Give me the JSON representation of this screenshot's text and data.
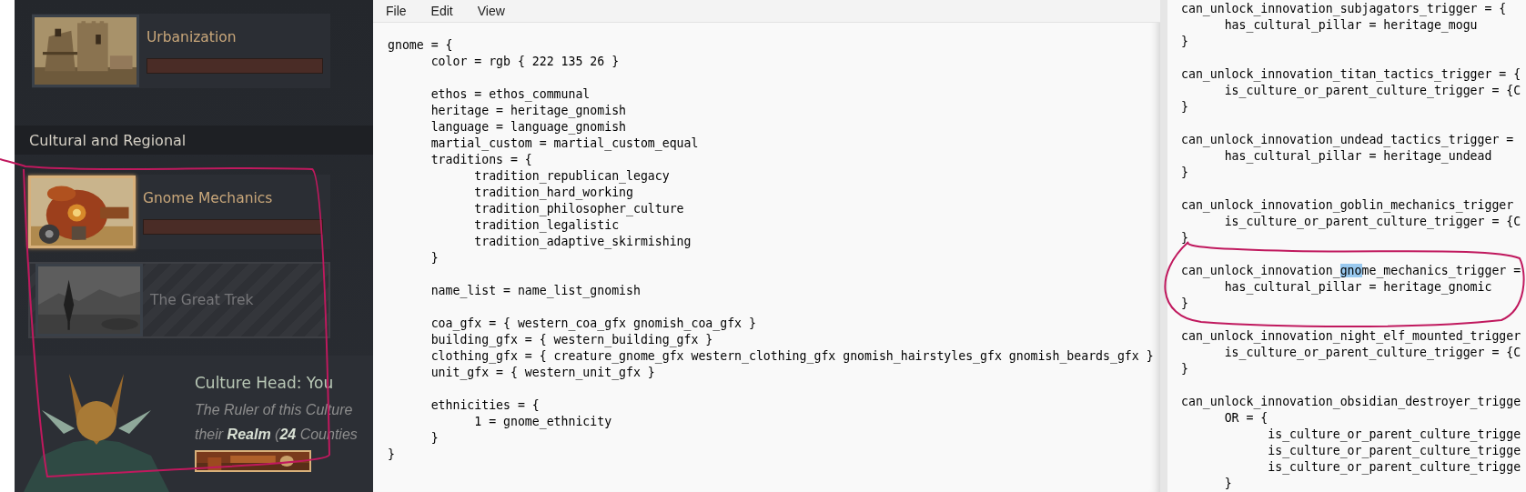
{
  "innovation_panel": {
    "cards": [
      {
        "title": "Urbanization",
        "selected": false,
        "locked": false
      }
    ],
    "section_title": "Cultural and Regional",
    "section_cards": [
      {
        "title": "Gnome Mechanics",
        "selected": true,
        "locked": false
      },
      {
        "title": "The Great Trek",
        "selected": false,
        "locked": true
      }
    ],
    "culture_head": {
      "title": "Culture Head: You",
      "description_lines": [
        "The Ruler of this Culture",
        "their **Realm** (**24** Counties"
      ]
    }
  },
  "notepad": {
    "menu": [
      "File",
      "Edit",
      "View"
    ],
    "blocks": [
      [
        "gnome = {",
        "\tcolor = rgb { 222 135 26 }"
      ],
      [
        "\tethos = ethos_communal",
        "\theritage = heritage_gnomish",
        "\tlanguage = language_gnomish",
        "\tmartial_custom = martial_custom_equal",
        "\ttraditions = {",
        "\t\ttradition_republican_legacy",
        "\t\ttradition_hard_working",
        "\t\ttradition_philosopher_culture",
        "\t\ttradition_legalistic",
        "\t\ttradition_adaptive_skirmishing",
        "\t}"
      ],
      [
        "\tname_list = name_list_gnomish"
      ],
      [
        "\tcoa_gfx = { western_coa_gfx gnomish_coa_gfx }",
        "\tbuilding_gfx = { western_building_gfx }",
        "\tclothing_gfx = { creature_gnome_gfx western_clothing_gfx gnomish_hairstyles_gfx gnomish_beards_gfx }",
        "\tunit_gfx = { western_unit_gfx }"
      ],
      [
        "\tethnicities = {",
        "\t\t1 = gnome_ethnicity",
        "\t}",
        "}"
      ]
    ]
  },
  "code_editor": {
    "blocks": [
      [
        "can_unlock_innovation_subjagators_trigger = {",
        "\thas_cultural_pillar = heritage_mogu",
        "}"
      ],
      [
        "can_unlock_innovation_titan_tactics_trigger = {",
        "\tis_culture_or_parent_culture_trigger = {C",
        "}"
      ],
      [
        "can_unlock_innovation_undead_tactics_trigger =",
        "\thas_cultural_pillar = heritage_undead",
        "}"
      ],
      [
        "can_unlock_innovation_goblin_mechanics_trigger",
        "\tis_culture_or_parent_culture_trigger = {C",
        "}"
      ],
      [
        {
          "segments": [
            {
              "text": "can_unlock_innovation_",
              "selected": false
            },
            {
              "text": "gno",
              "selected": true
            },
            {
              "text": "me_mechanics_trigger =",
              "selected": false
            }
          ]
        },
        "\thas_cultural_pillar = heritage_gnomic",
        "}"
      ],
      [
        "can_unlock_innovation_night_elf_mounted_trigger",
        "\tis_culture_or_parent_culture_trigger = {C",
        "}"
      ],
      [
        "can_unlock_innovation_obsidian_destroyer_trigge",
        "\tOR = {",
        "\t\tis_culture_or_parent_culture_trigge",
        "\t\tis_culture_or_parent_culture_trigge",
        "\t\tis_culture_or_parent_culture_trigge",
        "\t}"
      ]
    ]
  }
}
